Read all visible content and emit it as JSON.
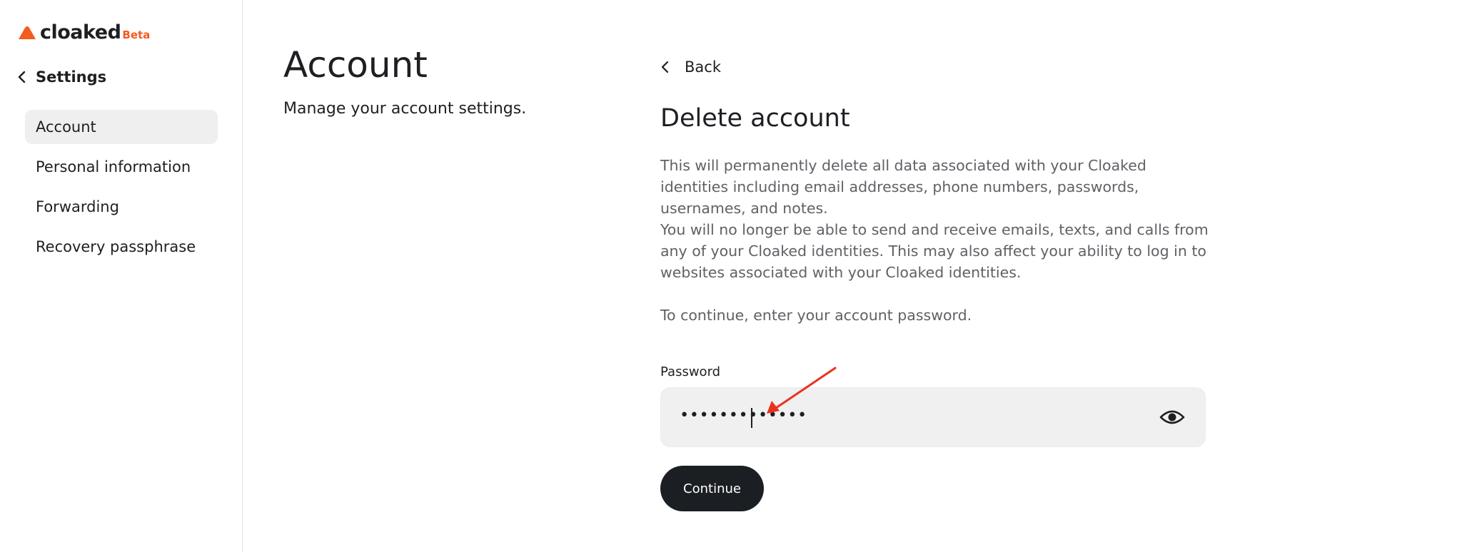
{
  "brand": {
    "name": "cloaked",
    "badge": "Beta",
    "accent_color": "#f35b1f"
  },
  "sidebar": {
    "back_label": "Settings",
    "items": [
      {
        "label": "Account",
        "active": true
      },
      {
        "label": "Personal information",
        "active": false
      },
      {
        "label": "Forwarding",
        "active": false
      },
      {
        "label": "Recovery passphrase",
        "active": false
      }
    ]
  },
  "account": {
    "title": "Account",
    "subtitle": "Manage your account settings."
  },
  "delete_panel": {
    "back_label": "Back",
    "title": "Delete account",
    "paragraphs": [
      "This will permanently delete all data associated with your Cloaked identities including email addresses, phone numbers, passwords, usernames, and notes.",
      "You will no longer be able to send and receive emails, texts, and calls from any of your Cloaked identities. This may also affect your ability to log in to websites associated with your Cloaked identities.",
      "To continue, enter your account password."
    ],
    "password_label": "Password",
    "password_value": "•••••••••••••",
    "continue_label": "Continue",
    "annotation_color": "#e8321f"
  }
}
